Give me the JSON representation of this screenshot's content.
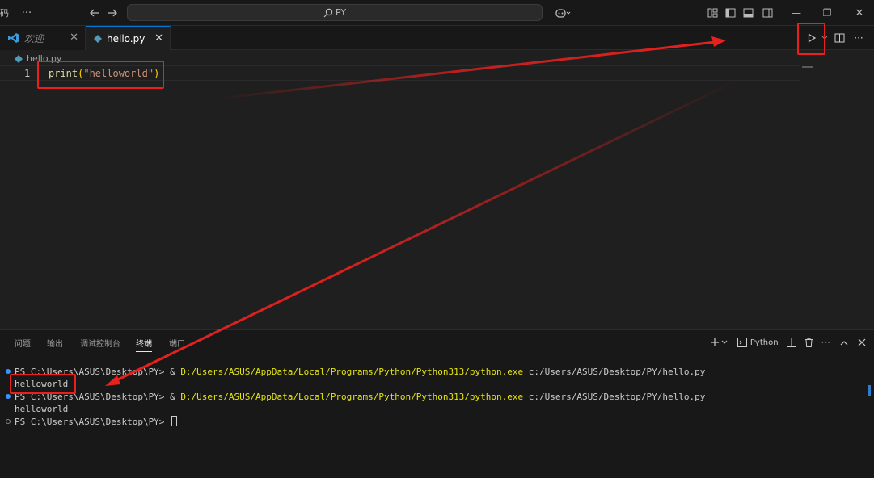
{
  "titlebar": {
    "left_fragment": "码",
    "menu_more": "···",
    "search_text": "PY",
    "icons": [
      "back-arrow-icon",
      "forward-arrow-icon",
      "search-icon",
      "copilot-icon",
      "layout-customize-icon",
      "toggle-sidebar-icon",
      "toggle-panel-icon",
      "toggle-secondary-sidebar-icon"
    ],
    "window_controls": {
      "minimize": "—",
      "restore": "❐",
      "close": "✕"
    }
  },
  "tabs": [
    {
      "label": "欢迎",
      "active": false,
      "close": "✕"
    },
    {
      "label": "hello.py",
      "active": true,
      "close": "✕"
    }
  ],
  "editor_actions": {
    "run": "run-icon",
    "split": "split-editor-icon",
    "more": "···"
  },
  "editor": {
    "breadcrumb": "hello.py",
    "line_number": "1",
    "code": {
      "fn": "print",
      "open": "(",
      "str": "\"helloworld\"",
      "close": ")"
    }
  },
  "panel": {
    "tabs": [
      {
        "label": "问题",
        "active": false
      },
      {
        "label": "输出",
        "active": false
      },
      {
        "label": "调试控制台",
        "active": false
      },
      {
        "label": "终端",
        "active": true
      },
      {
        "label": "端口",
        "active": false
      }
    ],
    "terminal_name": "Python",
    "actions": [
      "add-terminal-icon",
      "chevron-down-icon",
      "terminal-icon",
      "split-terminal-icon",
      "trash-icon",
      "more-icon",
      "maximize-chevron-up-icon",
      "close-icon"
    ],
    "more": "···"
  },
  "terminal": {
    "lines": [
      {
        "prompt": "PS C:\\Users\\ASUS\\Desktop\\PY> ",
        "amp": "& ",
        "exe": "D:/Users/ASUS/AppData/Local/Programs/Python/Python313/python.exe",
        "arg": " c:/Users/ASUS/Desktop/PY/hello.py"
      },
      {
        "text": "helloworld"
      },
      {
        "prompt": "PS C:\\Users\\ASUS\\Desktop\\PY> ",
        "amp": "& ",
        "exe": "D:/Users/ASUS/AppData/Local/Programs/Python/Python313/python.exe",
        "arg": " c:/Users/ASUS/Desktop/PY/hello.py"
      },
      {
        "text": "helloworld"
      },
      {
        "prompt": "PS C:\\Users\\ASUS\\Desktop\\PY> "
      }
    ]
  },
  "colors": {
    "annotation_red": "#e8211f",
    "accent_blue": "#0078d4",
    "python_icon": "#519aba",
    "terminal_exe_yellow": "#e5e510"
  }
}
